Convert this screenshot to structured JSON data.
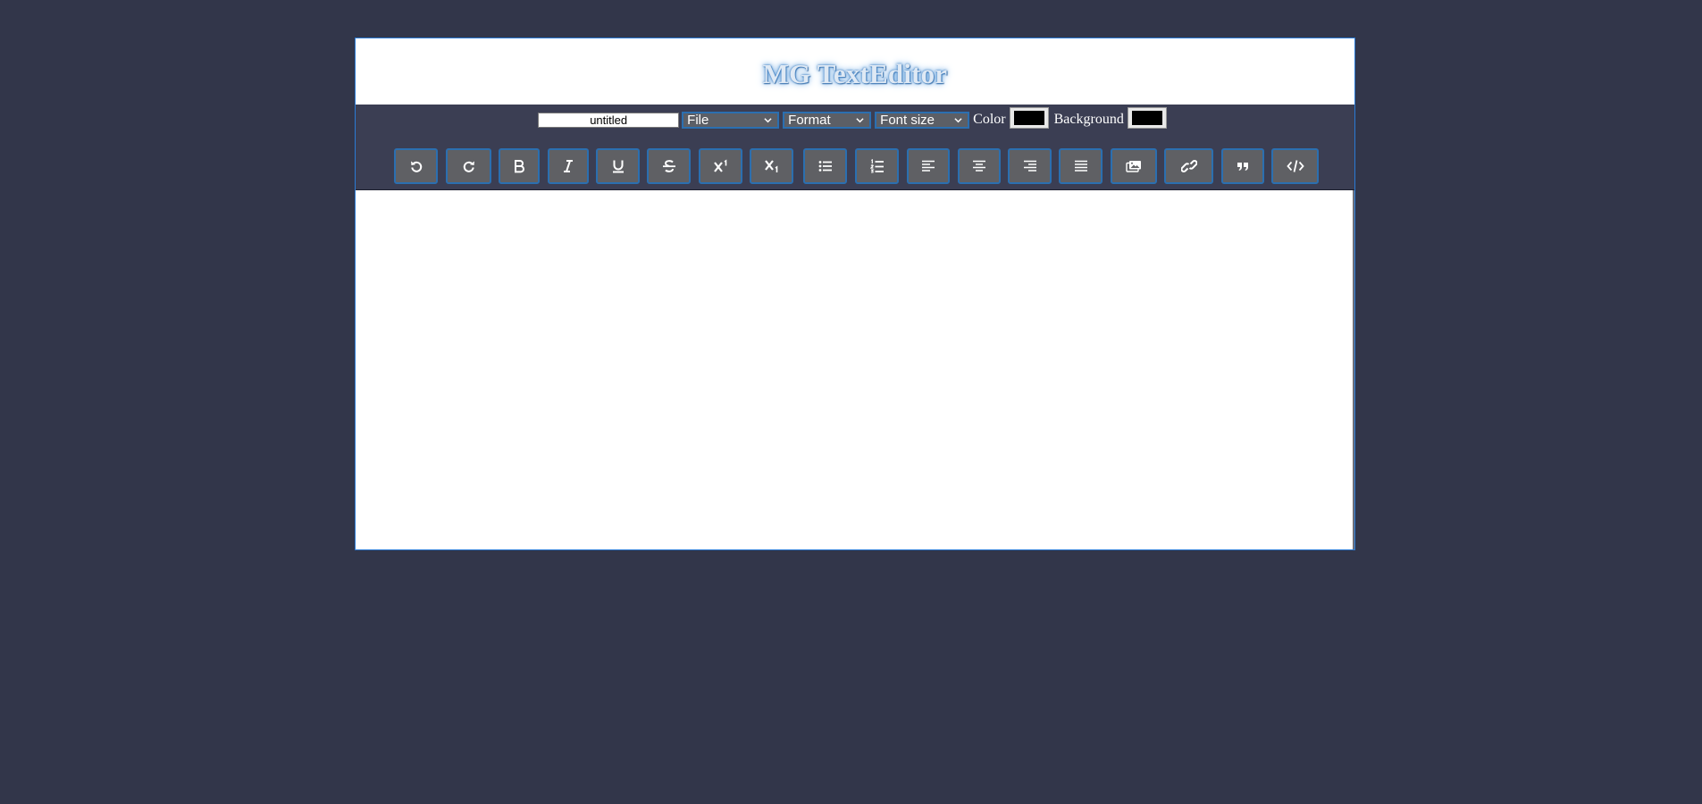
{
  "app": {
    "title": "MG TextEditor"
  },
  "toolbar": {
    "filename": {
      "value": "untitled"
    },
    "file_menu": {
      "selected": "File"
    },
    "format_menu": {
      "selected": "Format"
    },
    "font_size_menu": {
      "selected": "Font size"
    },
    "color_label": "Color",
    "color_value": "#000000",
    "background_label": "Background",
    "background_value": "#000000",
    "buttons": [
      {
        "name": "undo",
        "icon": "undo-icon"
      },
      {
        "name": "redo",
        "icon": "redo-icon"
      },
      {
        "name": "bold",
        "icon": "bold-icon"
      },
      {
        "name": "italic",
        "icon": "italic-icon"
      },
      {
        "name": "underline",
        "icon": "underline-icon"
      },
      {
        "name": "strikethrough",
        "icon": "strikethrough-icon"
      },
      {
        "name": "superscript",
        "icon": "superscript-icon"
      },
      {
        "name": "subscript",
        "icon": "subscript-icon"
      },
      {
        "name": "unordered-list",
        "icon": "bulleted-list-icon"
      },
      {
        "name": "ordered-list",
        "icon": "numbered-list-icon"
      },
      {
        "name": "align-left",
        "icon": "align-left-icon"
      },
      {
        "name": "align-center",
        "icon": "align-center-icon"
      },
      {
        "name": "align-right",
        "icon": "align-right-icon"
      },
      {
        "name": "justify",
        "icon": "align-justify-icon"
      },
      {
        "name": "insert-image",
        "icon": "images-icon"
      },
      {
        "name": "insert-link",
        "icon": "link-icon"
      },
      {
        "name": "blockquote",
        "icon": "quote-icon"
      },
      {
        "name": "code",
        "icon": "code-icon"
      }
    ]
  },
  "colors": {
    "page_background": "#32364a",
    "toolbar_background": "#3b3e53",
    "button_background": "#5f6064",
    "accent_border": "#2b6fb0"
  },
  "content": {
    "text": ""
  }
}
